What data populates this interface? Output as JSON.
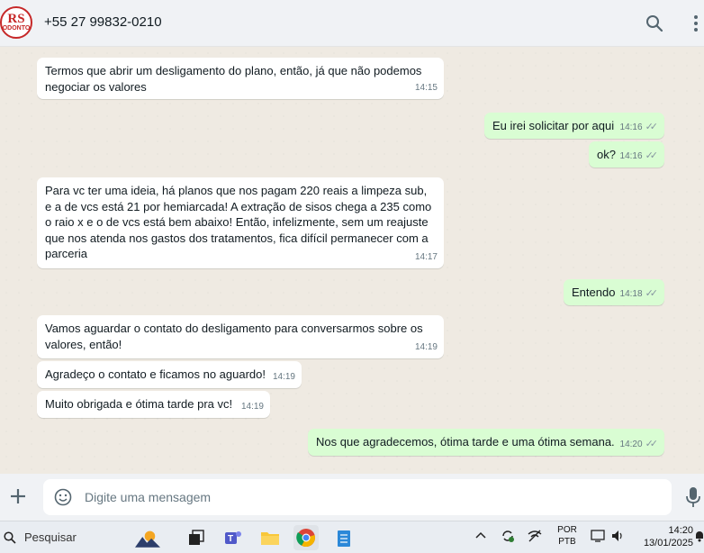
{
  "header": {
    "avatar_text_top": "RS",
    "avatar_text_bottom": "ODONTO",
    "contact_name": "+55 27 99832-0210",
    "icons": [
      "search-icon",
      "menu-icon"
    ]
  },
  "messages": [
    {
      "direction": "in",
      "text": "Termos que abrir um desligamento do plano, então, já que não podemos negociar os valores",
      "time": "14:15"
    },
    {
      "direction": "out",
      "text": "Eu irei solicitar por aqui",
      "time": "14:16"
    },
    {
      "direction": "out",
      "text": "ok?",
      "time": "14:16"
    },
    {
      "direction": "in",
      "text": "Para vc ter uma ideia, há planos que nos pagam 220 reais a limpeza sub, e a de vcs está 21 por hemiarcada! A extração de sisos chega a 235 como o raio x e o de vcs está bem abaixo! Então, infelizmente, sem um reajuste que nos atenda nos gastos dos tratamentos, fica difícil permanecer com a parceria",
      "time": "14:17"
    },
    {
      "direction": "out",
      "text": "Entendo",
      "time": "14:18"
    },
    {
      "direction": "in",
      "text": "Vamos aguardar o contato do desligamento para conversarmos sobre os valores, então!",
      "time": "14:19"
    },
    {
      "direction": "in",
      "text": "Agradeço o contato e ficamos no aguardo!",
      "time": "14:19"
    },
    {
      "direction": "in",
      "text": "Muito obrigada e ótima tarde pra vc!",
      "time": "14:19"
    },
    {
      "direction": "out",
      "text": "Nos que agradecemos, ótima tarde e uma ótima semana.",
      "time": "14:20"
    }
  ],
  "composer": {
    "placeholder": "Digite uma mensagem",
    "icons": [
      "plus-icon",
      "emoji-icon",
      "mic-icon"
    ]
  },
  "taskbar": {
    "search_label": "Pesquisar",
    "language_line1": "POR",
    "language_line2": "PTB",
    "time": "14:20",
    "date": "13/01/2025"
  },
  "colors": {
    "incoming_bubble": "#ffffff",
    "outgoing_bubble": "#d9fdd3",
    "chat_background": "#efeae2",
    "header_background": "#f0f2f5"
  }
}
